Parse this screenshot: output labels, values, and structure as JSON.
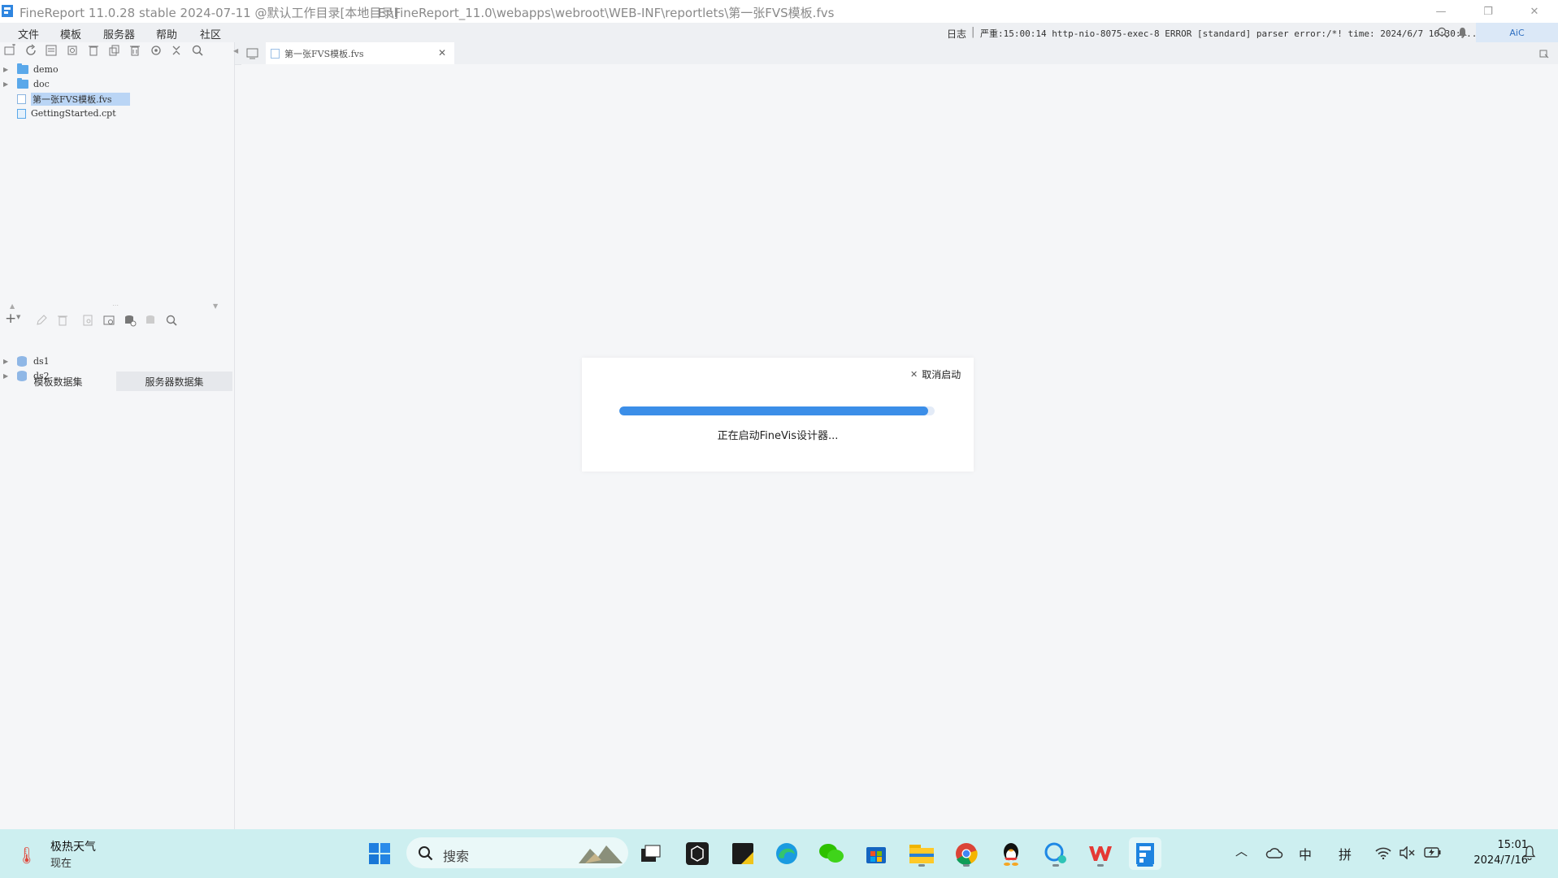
{
  "window": {
    "title": "FineReport 11.0.28 stable 2024-07-11 @默认工作目录[本地目录]",
    "path": "E:\\FineReport_11.0\\webapps\\webroot\\WEB-INF\\reportlets\\第一张FVS模板.fvs",
    "controls": {
      "minimize": "—",
      "restore": "❐",
      "close": "✕"
    }
  },
  "menu": {
    "items": [
      "文件",
      "模板",
      "服务器",
      "帮助",
      "社区"
    ],
    "log_label": "日志",
    "log_text": "严重:15:00:14 http-nio-8075-exec-8 ERROR [standard] parser error:/*! time: 2024/6/7 16:30:...",
    "aic_label": "AiC"
  },
  "file_tree": [
    {
      "name": "demo",
      "type": "folder",
      "expandable": true
    },
    {
      "name": "doc",
      "type": "folder",
      "expandable": true
    },
    {
      "name": "第一张FVS模板.fvs",
      "type": "fvs",
      "selected": true
    },
    {
      "name": "GettingStarted.cpt",
      "type": "cpt"
    }
  ],
  "dataset_tabs": [
    "模板数据集",
    "服务器数据集"
  ],
  "datasets": [
    {
      "name": "ds1"
    },
    {
      "name": "ds2"
    }
  ],
  "editor": {
    "tab_label": "第一张FVS模板.fvs"
  },
  "dialog": {
    "cancel_label": "取消启动",
    "message": "正在启动FineVis设计器...",
    "progress_percent": 98
  },
  "taskbar": {
    "weather_title": "极热天气",
    "weather_sub": "现在",
    "search_placeholder": "搜索",
    "clock_time": "15:01",
    "clock_date": "2024/7/16",
    "ime_lang": "中",
    "ime_mode": "拼",
    "colors": {
      "background": "#cdeff0",
      "accent": "#3b8ee8"
    }
  }
}
